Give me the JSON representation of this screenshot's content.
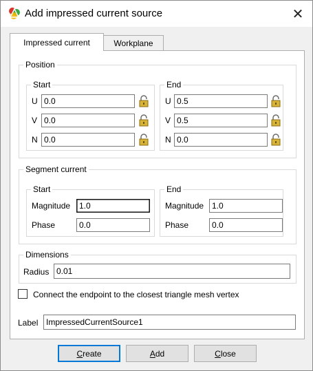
{
  "window": {
    "title": "Add impressed current source",
    "close_glyph": "✕"
  },
  "tabs": [
    {
      "label": "Impressed current",
      "active": true
    },
    {
      "label": "Workplane",
      "active": false
    }
  ],
  "position": {
    "title": "Position",
    "start": {
      "title": "Start",
      "fields": [
        {
          "label": "U",
          "value": "0.0"
        },
        {
          "label": "V",
          "value": "0.0"
        },
        {
          "label": "N",
          "value": "0.0"
        }
      ]
    },
    "end": {
      "title": "End",
      "fields": [
        {
          "label": "U",
          "value": "0.5"
        },
        {
          "label": "V",
          "value": "0.5"
        },
        {
          "label": "N",
          "value": "0.0"
        }
      ]
    }
  },
  "segment_current": {
    "title": "Segment current",
    "start": {
      "title": "Start",
      "magnitude_label": "Magnitude",
      "magnitude": "1.0",
      "phase_label": "Phase",
      "phase": "0.0"
    },
    "end": {
      "title": "End",
      "magnitude_label": "Magnitude",
      "magnitude": "1.0",
      "phase_label": "Phase",
      "phase": "0.0"
    }
  },
  "dimensions": {
    "title": "Dimensions",
    "radius_label": "Radius",
    "radius": "0.01"
  },
  "connect_checkbox": {
    "label": "Connect the endpoint to the closest triangle mesh vertex",
    "checked": false
  },
  "label_field": {
    "label": "Label",
    "value": "ImpressedCurrentSource1"
  },
  "buttons": {
    "create_first": "C",
    "create_rest": "reate",
    "add_first": "A",
    "add_rest": "dd",
    "close_first": "C",
    "close_rest": "lose"
  },
  "colors": {
    "default_button_border": "#0078d7",
    "lock_body": "#d8b33a"
  }
}
